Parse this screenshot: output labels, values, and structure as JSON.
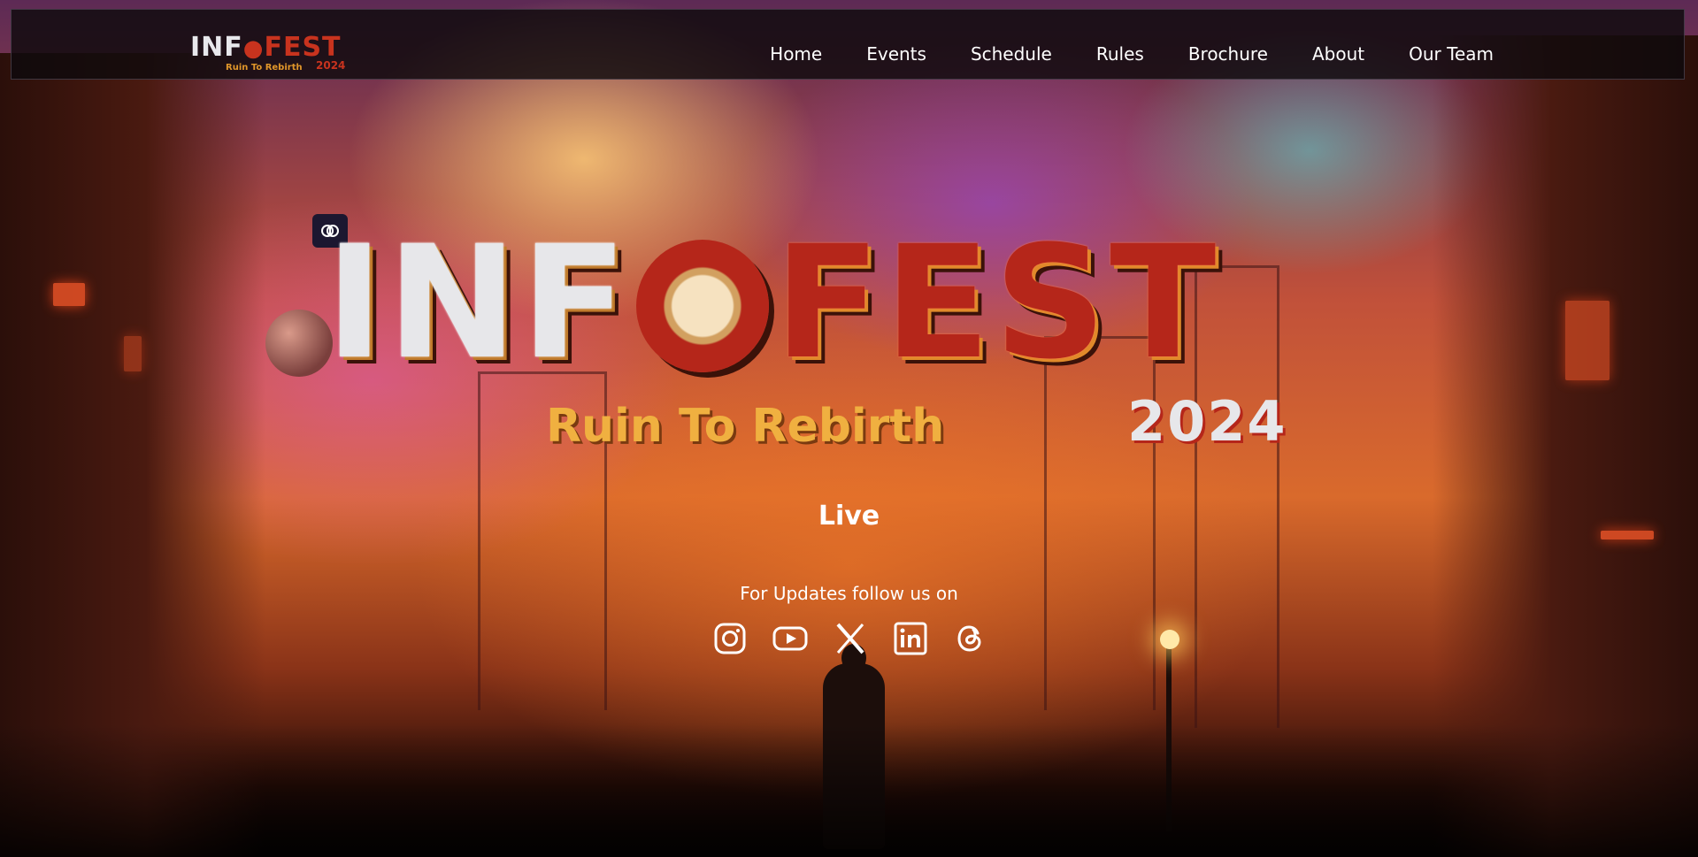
{
  "logo": {
    "word_white": "INF",
    "word_red": "FEST",
    "tagline": "Ruin To Rebirth",
    "year": "2024"
  },
  "nav": {
    "items": [
      {
        "label": "Home"
      },
      {
        "label": "Events"
      },
      {
        "label": "Schedule"
      },
      {
        "label": "Rules"
      },
      {
        "label": "Brochure"
      },
      {
        "label": "About"
      },
      {
        "label": "Our Team"
      }
    ]
  },
  "hero": {
    "title_white": "INF",
    "title_red": "FEST",
    "tagline": "Ruin To Rebirth",
    "year": "2024",
    "status": "Live",
    "follow_text": "For Updates follow us on"
  },
  "socials": [
    {
      "icon": "instagram-icon"
    },
    {
      "icon": "youtube-icon"
    },
    {
      "icon": "x-icon"
    },
    {
      "icon": "linkedin-icon"
    },
    {
      "icon": "threads-icon"
    }
  ],
  "colors": {
    "accent_red": "#b5261a",
    "accent_gold": "#f0b040",
    "nav_bg": "#0e0a0c"
  }
}
